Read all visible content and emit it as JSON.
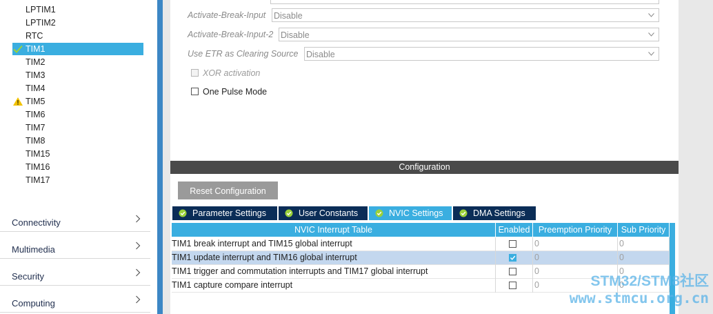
{
  "sidebar": {
    "peripherals": [
      {
        "label": "LPTIM1",
        "status": "none",
        "selected": false
      },
      {
        "label": "LPTIM2",
        "status": "none",
        "selected": false
      },
      {
        "label": "RTC",
        "status": "none",
        "selected": false
      },
      {
        "label": "TIM1",
        "status": "ok",
        "selected": true
      },
      {
        "label": "TIM2",
        "status": "none",
        "selected": false
      },
      {
        "label": "TIM3",
        "status": "none",
        "selected": false
      },
      {
        "label": "TIM4",
        "status": "none",
        "selected": false
      },
      {
        "label": "TIM5",
        "status": "warning",
        "selected": false
      },
      {
        "label": "TIM6",
        "status": "none",
        "selected": false
      },
      {
        "label": "TIM7",
        "status": "none",
        "selected": false
      },
      {
        "label": "TIM8",
        "status": "none",
        "selected": false
      },
      {
        "label": "TIM15",
        "status": "none",
        "selected": false
      },
      {
        "label": "TIM16",
        "status": "none",
        "selected": false
      },
      {
        "label": "TIM17",
        "status": "none",
        "selected": false
      }
    ],
    "categories": [
      {
        "label": "Connectivity"
      },
      {
        "label": "Multimedia"
      },
      {
        "label": "Security"
      },
      {
        "label": "Computing"
      }
    ]
  },
  "params": {
    "rows": [
      {
        "label": "Activate-Break-Input",
        "value": "Disable"
      },
      {
        "label": "Activate-Break-Input-2",
        "value": "Disable"
      },
      {
        "label": "Use ETR as Clearing Source",
        "value": "Disable"
      }
    ],
    "checkboxes": [
      {
        "label": "XOR activation",
        "checked": false,
        "disabled": true
      },
      {
        "label": "One Pulse Mode",
        "checked": false,
        "disabled": false
      }
    ]
  },
  "config": {
    "header": "Configuration",
    "reset_label": "Reset Configuration",
    "tabs": [
      {
        "label": "Parameter Settings",
        "active": false
      },
      {
        "label": "User Constants",
        "active": false
      },
      {
        "label": "NVIC Settings",
        "active": true
      },
      {
        "label": "DMA Settings",
        "active": false
      }
    ],
    "table": {
      "headers": [
        "NVIC Interrupt Table",
        "Enabled",
        "Preemption Priority",
        "Sub Priority"
      ],
      "rows": [
        {
          "name": "TIM1 break interrupt and TIM15 global interrupt",
          "enabled": false,
          "preemption": "0",
          "sub": "0",
          "selected": false
        },
        {
          "name": "TIM1 update interrupt and TIM16 global interrupt",
          "enabled": true,
          "preemption": "0",
          "sub": "0",
          "selected": true
        },
        {
          "name": "TIM1 trigger and commutation interrupts and TIM17 global interrupt",
          "enabled": false,
          "preemption": "0",
          "sub": "0",
          "selected": false
        },
        {
          "name": "TIM1 capture compare interrupt",
          "enabled": false,
          "preemption": "0",
          "sub": "0",
          "selected": false
        }
      ]
    }
  },
  "watermark": {
    "line1": "STM32/STM8社区",
    "line2": "www.stmcu.org.cn"
  },
  "colors": {
    "accent": "#3aaee0",
    "tab_dark": "#0b2d57",
    "header_dark": "#4a4a4a",
    "side_bar": "#3c87c5",
    "ok": "#9bd13a",
    "warning": "#f2c200"
  }
}
